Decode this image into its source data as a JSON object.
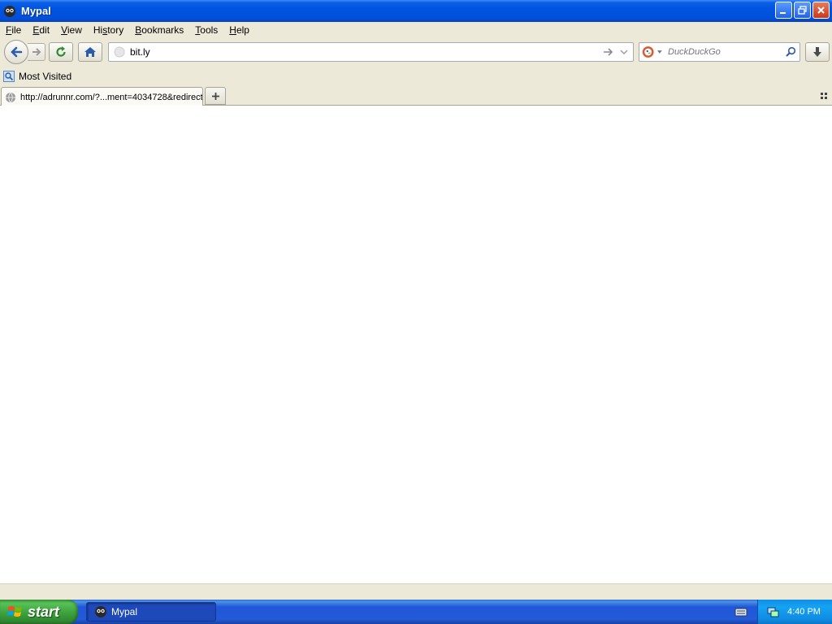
{
  "window": {
    "title": "Mypal"
  },
  "menu": {
    "items": [
      {
        "pre": "",
        "key": "F",
        "post": "ile"
      },
      {
        "pre": "",
        "key": "E",
        "post": "dit"
      },
      {
        "pre": "",
        "key": "V",
        "post": "iew"
      },
      {
        "pre": "Hi",
        "key": "s",
        "post": "tory"
      },
      {
        "pre": "",
        "key": "B",
        "post": "ookmarks"
      },
      {
        "pre": "",
        "key": "T",
        "post": "ools"
      },
      {
        "pre": "",
        "key": "H",
        "post": "elp"
      }
    ]
  },
  "navbar": {
    "url_value": "bit.ly",
    "search_placeholder": "DuckDuckGo",
    "icons": [
      "back-icon",
      "forward-icon",
      "reload-icon",
      "home-icon",
      "go-icon",
      "history-dropdown-icon",
      "duckduckgo-icon",
      "search-icon",
      "downloads-icon"
    ]
  },
  "bookmarks": {
    "items": [
      {
        "label": "Most Visited"
      }
    ]
  },
  "tabs": {
    "items": [
      {
        "label": "http://adrunnr.com/?...ment=4034728&redirect"
      }
    ]
  },
  "taskbar": {
    "start_label": "start",
    "tasks": [
      {
        "label": "Mypal"
      }
    ],
    "clock": "4:40 PM"
  },
  "colors": {
    "titlebar": "#0054e3",
    "chrome": "#ece9d8",
    "taskbar": "#245edb",
    "start": "#3c9a3c",
    "tray": "#0f8ee9"
  }
}
